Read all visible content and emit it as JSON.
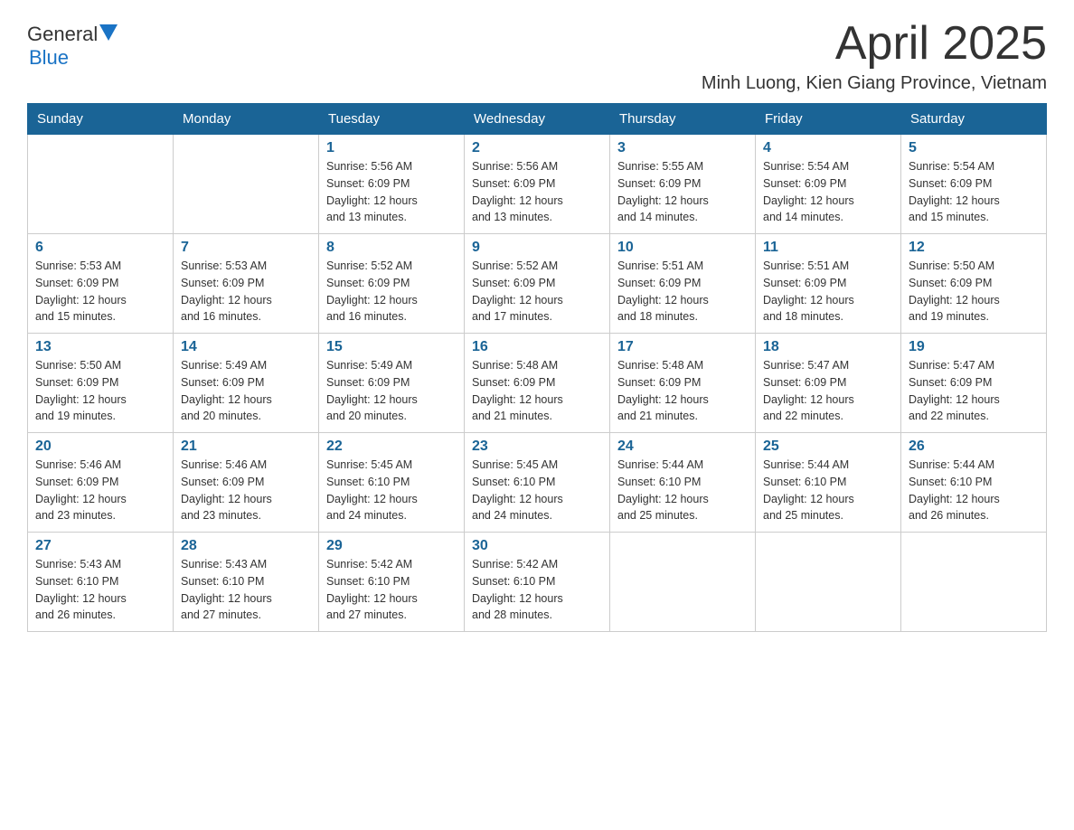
{
  "logo": {
    "general": "General",
    "blue": "Blue"
  },
  "header": {
    "month": "April 2025",
    "location": "Minh Luong, Kien Giang Province, Vietnam"
  },
  "days_of_week": [
    "Sunday",
    "Monday",
    "Tuesday",
    "Wednesday",
    "Thursday",
    "Friday",
    "Saturday"
  ],
  "weeks": [
    [
      {
        "day": "",
        "info": ""
      },
      {
        "day": "",
        "info": ""
      },
      {
        "day": "1",
        "info": "Sunrise: 5:56 AM\nSunset: 6:09 PM\nDaylight: 12 hours\nand 13 minutes."
      },
      {
        "day": "2",
        "info": "Sunrise: 5:56 AM\nSunset: 6:09 PM\nDaylight: 12 hours\nand 13 minutes."
      },
      {
        "day": "3",
        "info": "Sunrise: 5:55 AM\nSunset: 6:09 PM\nDaylight: 12 hours\nand 14 minutes."
      },
      {
        "day": "4",
        "info": "Sunrise: 5:54 AM\nSunset: 6:09 PM\nDaylight: 12 hours\nand 14 minutes."
      },
      {
        "day": "5",
        "info": "Sunrise: 5:54 AM\nSunset: 6:09 PM\nDaylight: 12 hours\nand 15 minutes."
      }
    ],
    [
      {
        "day": "6",
        "info": "Sunrise: 5:53 AM\nSunset: 6:09 PM\nDaylight: 12 hours\nand 15 minutes."
      },
      {
        "day": "7",
        "info": "Sunrise: 5:53 AM\nSunset: 6:09 PM\nDaylight: 12 hours\nand 16 minutes."
      },
      {
        "day": "8",
        "info": "Sunrise: 5:52 AM\nSunset: 6:09 PM\nDaylight: 12 hours\nand 16 minutes."
      },
      {
        "day": "9",
        "info": "Sunrise: 5:52 AM\nSunset: 6:09 PM\nDaylight: 12 hours\nand 17 minutes."
      },
      {
        "day": "10",
        "info": "Sunrise: 5:51 AM\nSunset: 6:09 PM\nDaylight: 12 hours\nand 18 minutes."
      },
      {
        "day": "11",
        "info": "Sunrise: 5:51 AM\nSunset: 6:09 PM\nDaylight: 12 hours\nand 18 minutes."
      },
      {
        "day": "12",
        "info": "Sunrise: 5:50 AM\nSunset: 6:09 PM\nDaylight: 12 hours\nand 19 minutes."
      }
    ],
    [
      {
        "day": "13",
        "info": "Sunrise: 5:50 AM\nSunset: 6:09 PM\nDaylight: 12 hours\nand 19 minutes."
      },
      {
        "day": "14",
        "info": "Sunrise: 5:49 AM\nSunset: 6:09 PM\nDaylight: 12 hours\nand 20 minutes."
      },
      {
        "day": "15",
        "info": "Sunrise: 5:49 AM\nSunset: 6:09 PM\nDaylight: 12 hours\nand 20 minutes."
      },
      {
        "day": "16",
        "info": "Sunrise: 5:48 AM\nSunset: 6:09 PM\nDaylight: 12 hours\nand 21 minutes."
      },
      {
        "day": "17",
        "info": "Sunrise: 5:48 AM\nSunset: 6:09 PM\nDaylight: 12 hours\nand 21 minutes."
      },
      {
        "day": "18",
        "info": "Sunrise: 5:47 AM\nSunset: 6:09 PM\nDaylight: 12 hours\nand 22 minutes."
      },
      {
        "day": "19",
        "info": "Sunrise: 5:47 AM\nSunset: 6:09 PM\nDaylight: 12 hours\nand 22 minutes."
      }
    ],
    [
      {
        "day": "20",
        "info": "Sunrise: 5:46 AM\nSunset: 6:09 PM\nDaylight: 12 hours\nand 23 minutes."
      },
      {
        "day": "21",
        "info": "Sunrise: 5:46 AM\nSunset: 6:09 PM\nDaylight: 12 hours\nand 23 minutes."
      },
      {
        "day": "22",
        "info": "Sunrise: 5:45 AM\nSunset: 6:10 PM\nDaylight: 12 hours\nand 24 minutes."
      },
      {
        "day": "23",
        "info": "Sunrise: 5:45 AM\nSunset: 6:10 PM\nDaylight: 12 hours\nand 24 minutes."
      },
      {
        "day": "24",
        "info": "Sunrise: 5:44 AM\nSunset: 6:10 PM\nDaylight: 12 hours\nand 25 minutes."
      },
      {
        "day": "25",
        "info": "Sunrise: 5:44 AM\nSunset: 6:10 PM\nDaylight: 12 hours\nand 25 minutes."
      },
      {
        "day": "26",
        "info": "Sunrise: 5:44 AM\nSunset: 6:10 PM\nDaylight: 12 hours\nand 26 minutes."
      }
    ],
    [
      {
        "day": "27",
        "info": "Sunrise: 5:43 AM\nSunset: 6:10 PM\nDaylight: 12 hours\nand 26 minutes."
      },
      {
        "day": "28",
        "info": "Sunrise: 5:43 AM\nSunset: 6:10 PM\nDaylight: 12 hours\nand 27 minutes."
      },
      {
        "day": "29",
        "info": "Sunrise: 5:42 AM\nSunset: 6:10 PM\nDaylight: 12 hours\nand 27 minutes."
      },
      {
        "day": "30",
        "info": "Sunrise: 5:42 AM\nSunset: 6:10 PM\nDaylight: 12 hours\nand 28 minutes."
      },
      {
        "day": "",
        "info": ""
      },
      {
        "day": "",
        "info": ""
      },
      {
        "day": "",
        "info": ""
      }
    ]
  ]
}
